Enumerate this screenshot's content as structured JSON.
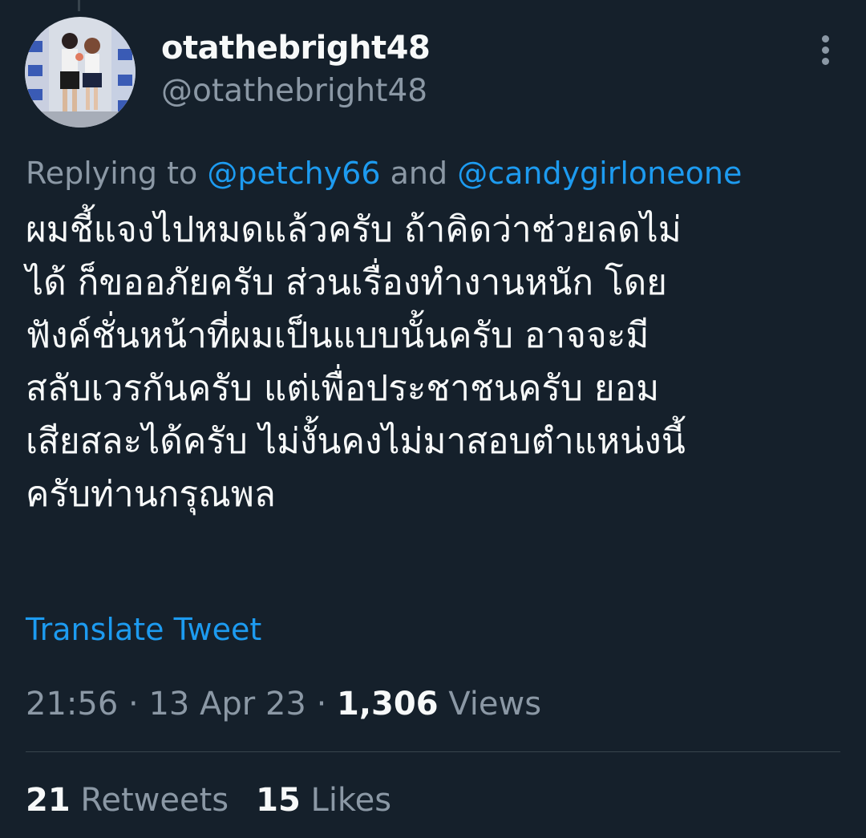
{
  "author": {
    "display_name": "otathebright48",
    "handle": "@otathebright48"
  },
  "reply": {
    "prefix": "Replying to ",
    "mention_1": "@petchy66",
    "conjunction": " and ",
    "mention_2": "@candygirloneone"
  },
  "tweet": {
    "lines": [
      "ผมชี้แจงไปหมดแล้วครับ ถ้าคิดว่าช่วยลดไม่",
      "ได้ ก็ขออภัยครับ ส่วนเรื่องทำงานหนัก โดย",
      "ฟังค์ชั่นหน้าที่ผมเป็นแบบนั้นครับ อาจจะมี",
      "สลับเวรกันครับ แต่เพื่อประชาชนครับ ยอม",
      "เสียสละได้ครับ ไม่งั้นคงไม่มาสอบตำแหน่งนี้",
      "ครับท่านกรุณพล"
    ],
    "translate_label": "Translate Tweet"
  },
  "meta": {
    "time": "21:56",
    "separator": " · ",
    "date": "13 Apr 23",
    "views_count": "1,306",
    "views_label": " Views"
  },
  "stats": {
    "retweets_count": "21",
    "retweets_label": " Retweets",
    "likes_count": "15",
    "likes_label": " Likes"
  },
  "icons": {
    "more": "more-vertical-icon"
  },
  "colors": {
    "background": "#15202b",
    "text_primary": "#f7f9f9",
    "text_secondary": "#8b98a5",
    "accent": "#1d9bf0",
    "divider": "#38444d"
  }
}
